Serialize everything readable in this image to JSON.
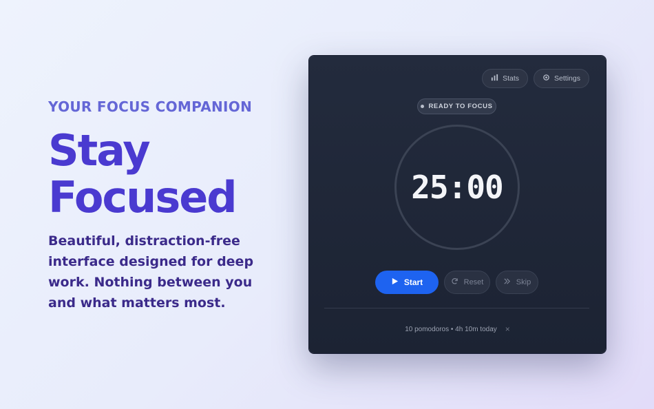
{
  "hero": {
    "eyebrow": "YOUR FOCUS COMPANION",
    "headline_line1": "Stay",
    "headline_line2": "Focused",
    "subcopy": "Beautiful, distraction-free interface designed for deep work. Nothing between you and what matters most."
  },
  "toolbar": {
    "stats_label": "Stats",
    "stats_icon": "bar-chart-icon",
    "settings_label": "Settings",
    "settings_icon": "gear-icon"
  },
  "status": {
    "label": "READY TO FOCUS"
  },
  "timer": {
    "display": "25:00"
  },
  "controls": {
    "start_label": "Start",
    "start_icon": "play-icon",
    "reset_label": "Reset",
    "reset_icon": "refresh-icon",
    "skip_label": "Skip",
    "skip_icon": "double-chevron-right-icon"
  },
  "footer": {
    "summary": "10 pomodoros • 4h 10m today",
    "dismiss": "×"
  },
  "colors": {
    "accent": "#1e63f0",
    "headline": "#4a3ad0",
    "window_bg": "#1f2738"
  }
}
